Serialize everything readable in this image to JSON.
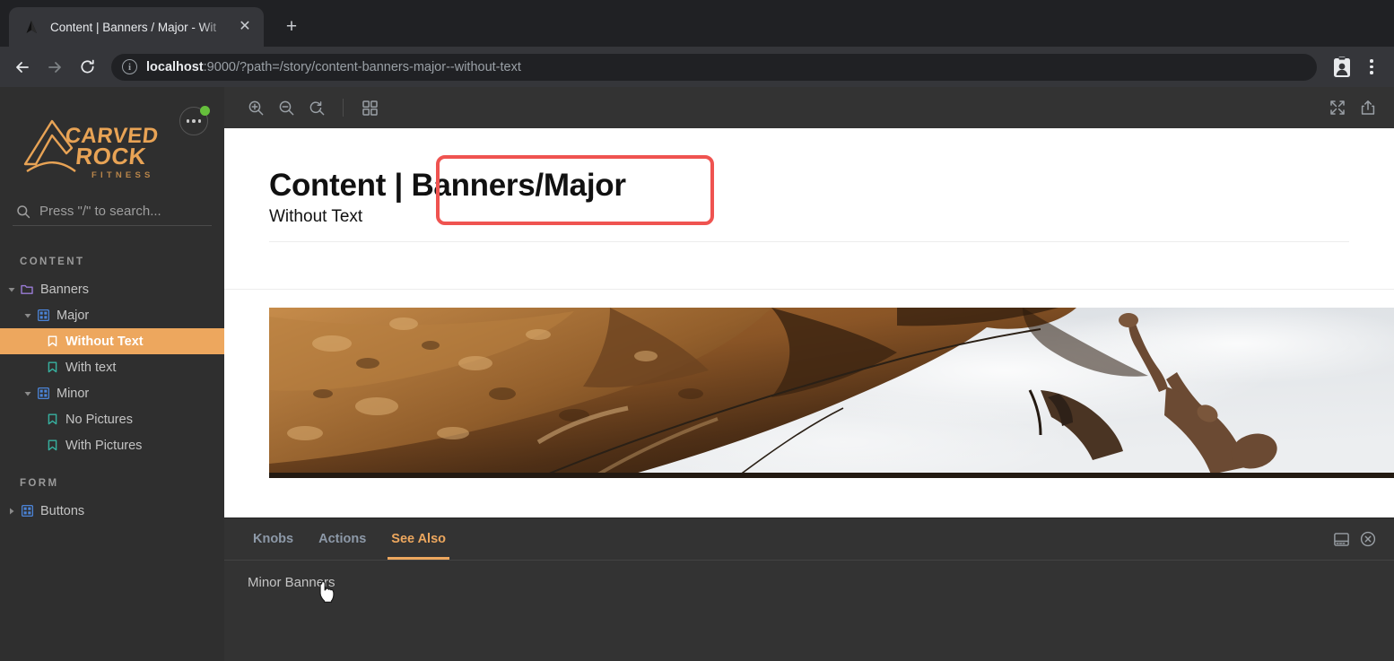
{
  "browser": {
    "tab": {
      "title": "Content | Banners / Major - Wit",
      "favicon_name": "mountain-favicon",
      "close_glyph": "✕"
    },
    "new_tab_glyph": "+",
    "nav": {
      "back_glyph": "←",
      "forward_glyph": "→",
      "reload_glyph": "↻"
    },
    "omnibox": {
      "info_glyph": "i",
      "host": "localhost",
      "rest": ":9000/?path=/story/content-banners-major--without-text",
      "full_url": "localhost:9000/?path=/story/content-banners-major--without-text"
    },
    "profile_icon_name": "profile-badge-icon",
    "menu_icon_name": "browser-menu-icon"
  },
  "sidebar": {
    "logo": {
      "line1": "CARVED",
      "line2": "ROCK",
      "line3": "F I T N E S S",
      "color": "#e8a355"
    },
    "menu_button_name": "sidebar-menu-button",
    "status_dot_color": "#66bf3c",
    "search": {
      "placeholder": "Press \"/\" to search...",
      "value": ""
    },
    "sections": [
      {
        "title": "CONTENT",
        "items": [
          {
            "label": "Banners",
            "depth": 0,
            "icon": "folder-icon",
            "caret": "down",
            "selected": false,
            "icon_color": "#9a7cd6"
          },
          {
            "label": "Major",
            "depth": 1,
            "icon": "component-grid-icon",
            "caret": "down",
            "selected": false,
            "icon_color": "#4b84d8"
          },
          {
            "label": "Without Text",
            "depth": 2,
            "icon": "bookmark-icon",
            "caret": "none",
            "selected": true,
            "icon_color": "#ffffff"
          },
          {
            "label": "With text",
            "depth": 2,
            "icon": "bookmark-icon",
            "caret": "none",
            "selected": false,
            "icon_color": "#37b1a0"
          },
          {
            "label": "Minor",
            "depth": 1,
            "icon": "component-grid-icon",
            "caret": "down",
            "selected": false,
            "icon_color": "#4b84d8"
          },
          {
            "label": "No Pictures",
            "depth": 2,
            "icon": "bookmark-icon",
            "caret": "none",
            "selected": false,
            "icon_color": "#37b1a0"
          },
          {
            "label": "With Pictures",
            "depth": 2,
            "icon": "bookmark-icon",
            "caret": "none",
            "selected": false,
            "icon_color": "#37b1a0"
          }
        ]
      },
      {
        "title": "FORM",
        "items": [
          {
            "label": "Buttons",
            "depth": 0,
            "icon": "component-grid-icon",
            "caret": "right",
            "selected": false,
            "icon_color": "#4b84d8"
          }
        ]
      }
    ]
  },
  "toolbar": {
    "left": [
      {
        "name": "zoom-in-icon"
      },
      {
        "name": "zoom-out-icon"
      },
      {
        "name": "zoom-reset-icon"
      },
      {
        "name": "grid-background-icon"
      }
    ],
    "right": [
      {
        "name": "fullscreen-icon"
      },
      {
        "name": "open-in-new-tab-icon"
      }
    ]
  },
  "story": {
    "title_prefix": "Content | ",
    "title_highlight": "Banners/Major",
    "subtitle": "Without Text",
    "annotation_color": "#ef5350",
    "banner_alt": "rock-climber-banner-image"
  },
  "panel": {
    "tabs": [
      {
        "label": "Knobs",
        "active": false
      },
      {
        "label": "Actions",
        "active": false
      },
      {
        "label": "See Also",
        "active": true
      }
    ],
    "content_link": "Minor Banners",
    "buttons": [
      {
        "name": "panel-position-icon"
      },
      {
        "name": "close-panel-icon"
      }
    ],
    "accent_color": "#eda75e"
  }
}
